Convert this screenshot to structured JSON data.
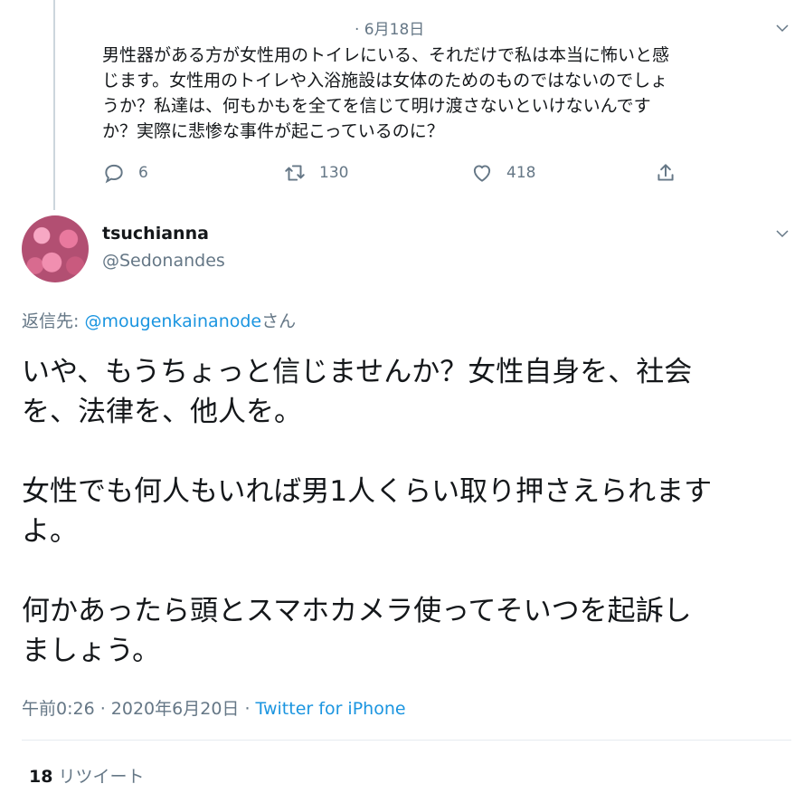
{
  "parent_tweet": {
    "date": "· 6月18日",
    "text": "男性器がある方が女性用のトイレにいる、それだけで私は本当に怖いと感\nじます。女性用のトイレや入浴施設は女体のためのものではないのでしょ\nうか？私達は、何もかもを全てを信じて明け渡さないといけないんです\nか？実際に悲惨な事件が起こっているのに？",
    "actions": {
      "reply_count": "6",
      "retweet_count": "130",
      "like_count": "418"
    }
  },
  "tweet": {
    "display_name": "tsuchianna",
    "handle": "@Sedonandes",
    "reply_prefix": "返信先: ",
    "reply_mention": "@mougenkainanode",
    "reply_suffix": "さん",
    "text": "いや、もうちょっと信じませんか？女性自身を、社会\nを、法律を、他人を。\n\n女性でも何人もいれば男1人くらい取り押さえられます\nよ。\n\n何かあったら頭とスマホカメラ使ってそいつを起訴し\nましょう。",
    "timestamp": "午前0:26 · 2020年6月20日 · ",
    "source": "Twitter for iPhone",
    "retweet_count": "18",
    "retweet_label": "リツイート"
  },
  "icons": {
    "reply": "reply-icon",
    "retweet": "retweet-icon",
    "like": "heart-icon",
    "share": "share-icon",
    "caret": "chevron-down-icon"
  },
  "colors": {
    "text": "#14171a",
    "secondary": "#657786",
    "link": "#1b95e0",
    "thread_line": "#ccd6dd"
  }
}
